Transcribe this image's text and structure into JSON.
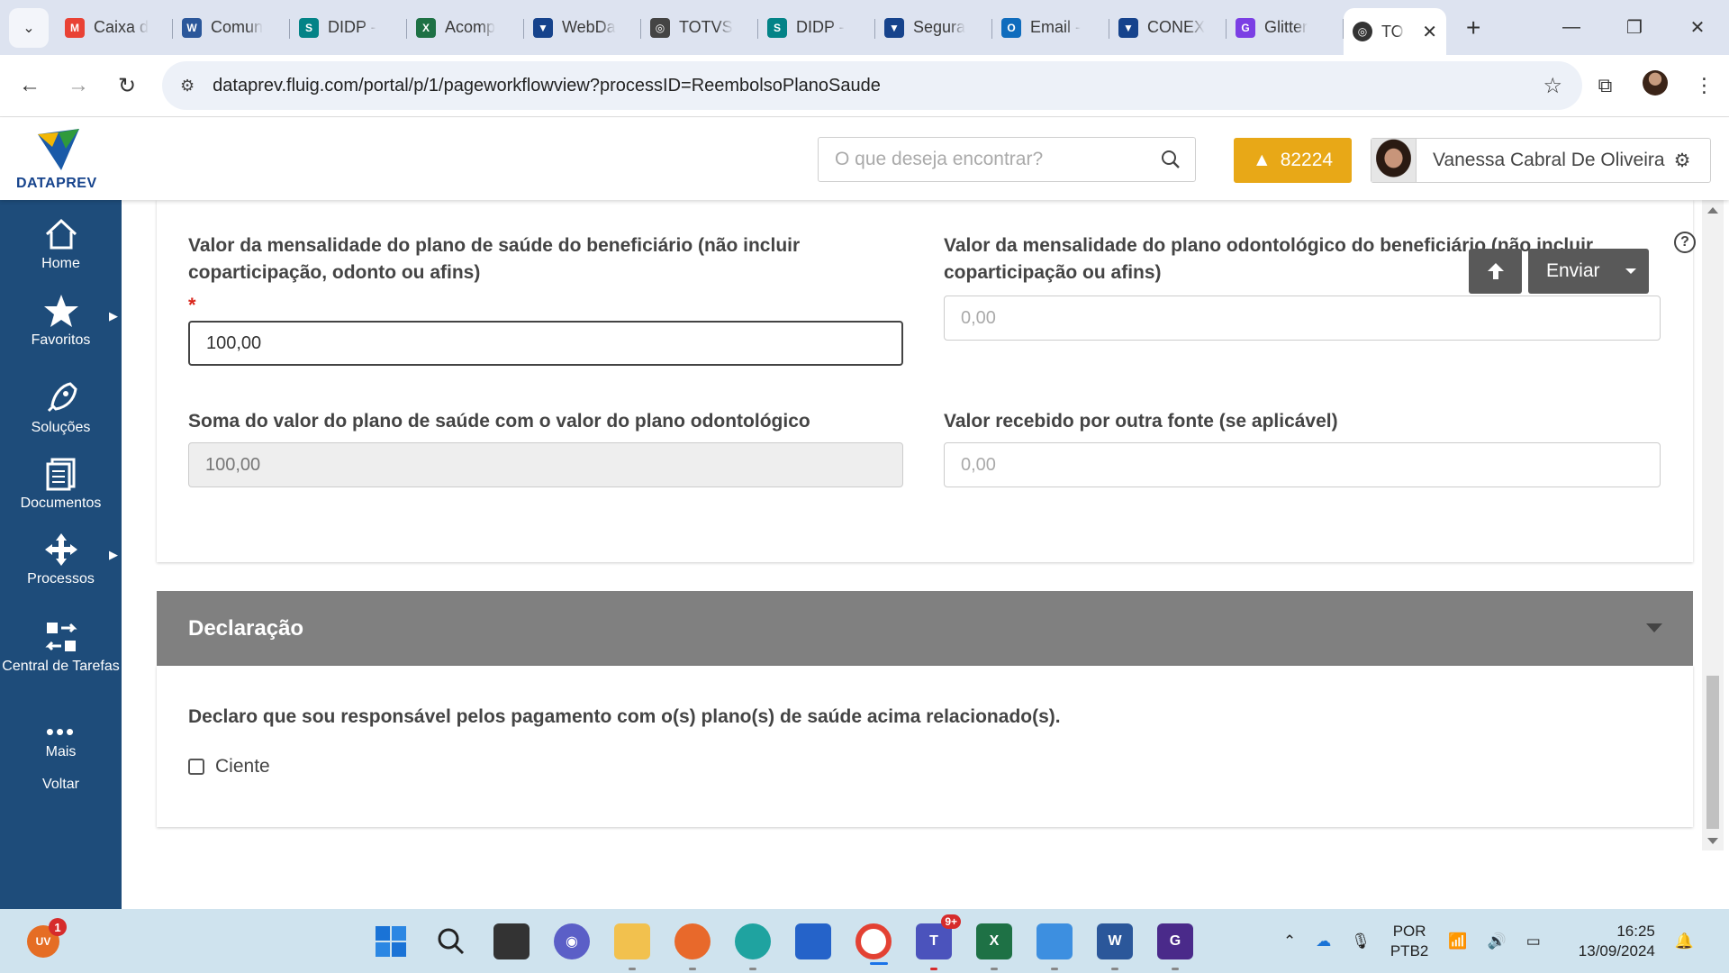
{
  "browser": {
    "tabs": [
      {
        "label": "Caixa d",
        "color": "#e94235",
        "glyph": "M"
      },
      {
        "label": "Comun",
        "color": "#2b579a",
        "glyph": "W"
      },
      {
        "label": "DIDP -",
        "color": "#038387",
        "glyph": "S"
      },
      {
        "label": "Acomp",
        "color": "#1e7145",
        "glyph": "X"
      },
      {
        "label": "WebDa",
        "color": "#16438c",
        "glyph": "▼"
      },
      {
        "label": "TOTVS",
        "color": "#444444",
        "glyph": "◎"
      },
      {
        "label": "DIDP -",
        "color": "#038387",
        "glyph": "S"
      },
      {
        "label": "Segura",
        "color": "#16438c",
        "glyph": "▼"
      },
      {
        "label": "Email -",
        "color": "#0f6cbd",
        "glyph": "O"
      },
      {
        "label": "CONEX",
        "color": "#16438c",
        "glyph": "▼"
      },
      {
        "label": "Glitter",
        "color": "#7b3fe4",
        "glyph": "G"
      }
    ],
    "active_tab": {
      "label": "TO",
      "close": "✕"
    },
    "new_tab": "+",
    "url": "dataprev.fluig.com/portal/p/1/pageworkflowview?processID=ReembolsoPlanoSaude"
  },
  "header": {
    "logo_text": "DATAPREV",
    "search_placeholder": "O que deseja encontrar?",
    "alert_count": "82224",
    "user_name": "Vanessa Cabral De Oliveira"
  },
  "sidebar": {
    "items": [
      {
        "label": "Home"
      },
      {
        "label": "Favoritos"
      },
      {
        "label": "Soluções"
      },
      {
        "label": "Documentos"
      },
      {
        "label": "Processos"
      },
      {
        "label": "Central de Tarefas"
      },
      {
        "label": "Mais"
      },
      {
        "label": "Voltar"
      }
    ]
  },
  "form": {
    "field1": {
      "label": "Valor da mensalidade do plano de saúde do beneficiário (não incluir coparticipação, odonto ou afins)",
      "required_mark": "*",
      "value": "100,00"
    },
    "field2": {
      "label": "Valor da mensalidade do plano odontológico do beneficiário (não incluir coparticipação ou afins)",
      "placeholder": "0,00"
    },
    "field3": {
      "label": "Soma do valor do plano de saúde com o valor do plano odontológico",
      "value": "100,00"
    },
    "field4": {
      "label": "Valor recebido por outra fonte (se aplicável)",
      "placeholder": "0,00"
    },
    "send_label": "Enviar",
    "help": "?"
  },
  "declaration": {
    "title": "Declaração",
    "text": "Declaro que sou responsável pelos pagamento com o(s) plano(s) de saúde acima relacionado(s).",
    "checkbox_label": "Ciente"
  },
  "taskbar": {
    "weather_badge": "1",
    "weather_text": "UV",
    "teams_badge": "9+",
    "lang_top": "POR",
    "lang_bottom": "PTB2",
    "time": "16:25",
    "date": "13/09/2024"
  }
}
